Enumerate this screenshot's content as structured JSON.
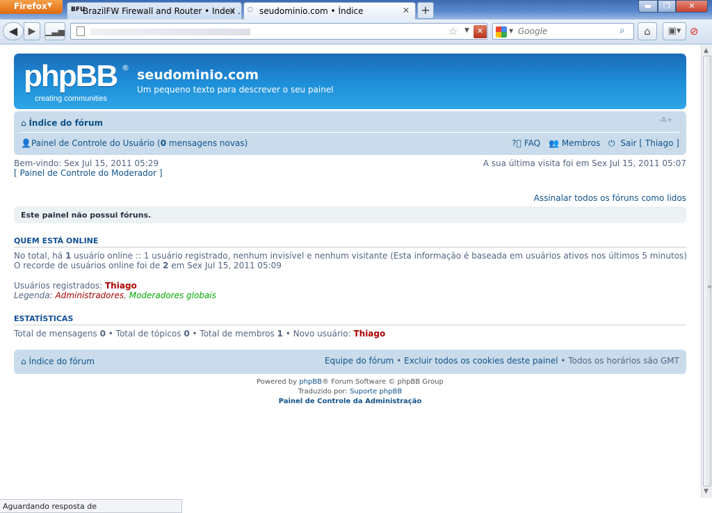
{
  "browser": {
    "app_button": "Firefox",
    "tabs": [
      {
        "icon": "BFU",
        "label": "BrazilFW Firewall and Router • Index ..."
      },
      {
        "icon": "",
        "label": "seudominio.com • Índice"
      }
    ],
    "search_placeholder": "Google",
    "status": "Aguardando resposta de"
  },
  "site": {
    "logo_text": "phpBB",
    "logo_registered": "®",
    "logo_tagline": "creating communities",
    "title": "seudominio.com",
    "description": "Um pequeno texto para descrever o seu painel"
  },
  "nav": {
    "home": "Índice do fórum",
    "font_size": "-A+",
    "ucp_prefix": "Painel de Controle do Usuário (",
    "ucp_count": "0",
    "ucp_suffix": " mensagens novas)",
    "faq": "FAQ",
    "members": "Membros",
    "logout": "Sair [ Thiago ]"
  },
  "welcome": {
    "line1": "Bem-vindo: Sex Jul 15, 2011 05:29",
    "line2": "[ Painel de Controle do Moderador ]",
    "last_visit": "A sua última visita foi em Sex Jul 15, 2011 05:07"
  },
  "mark_read": "Assinalar todos os fóruns como lidos",
  "no_forums": "Este painel não possui fóruns.",
  "online": {
    "title": "QUEM ESTÁ ONLINE",
    "l1_a": "No total, há ",
    "l1_count": "1",
    "l1_b": " usuário online :: 1 usuário registrado, nenhum invisível e nenhum visitante (Esta informação é baseada em usuários ativos nos últimos 5 minutos)",
    "l2_a": "O recorde de usuários online foi de ",
    "l2_count": "2",
    "l2_b": " em Sex Jul 15, 2011 05:09",
    "registered_label": "Usuários registrados: ",
    "registered_user": "Thiago",
    "legend_label": "Legenda: ",
    "legend_admins": "Administradores",
    "legend_sep": ", ",
    "legend_mods": "Moderadores globais"
  },
  "stats": {
    "title": "ESTATÍSTICAS",
    "posts_label": "Total de mensagens ",
    "posts": "0",
    "topics_label": " • Total de tópicos ",
    "topics": "0",
    "members_label": " • Total de membros ",
    "members": "1",
    "newest_label": " • Novo usuário: ",
    "newest": "Thiago"
  },
  "footer": {
    "home": "Índice do fórum",
    "team": "Equipe do fórum",
    "sep": " • ",
    "cookies": "Excluir todos os cookies deste painel",
    "timezone": "Todos os horários são GMT",
    "powered_a": "Powered by ",
    "powered_link": "phpBB",
    "powered_b": "® Forum Software © phpBB Group",
    "translated_a": "Traduzido por: ",
    "translated_link": "Suporte phpBB",
    "acp": "Painel de Controle da Administração"
  }
}
